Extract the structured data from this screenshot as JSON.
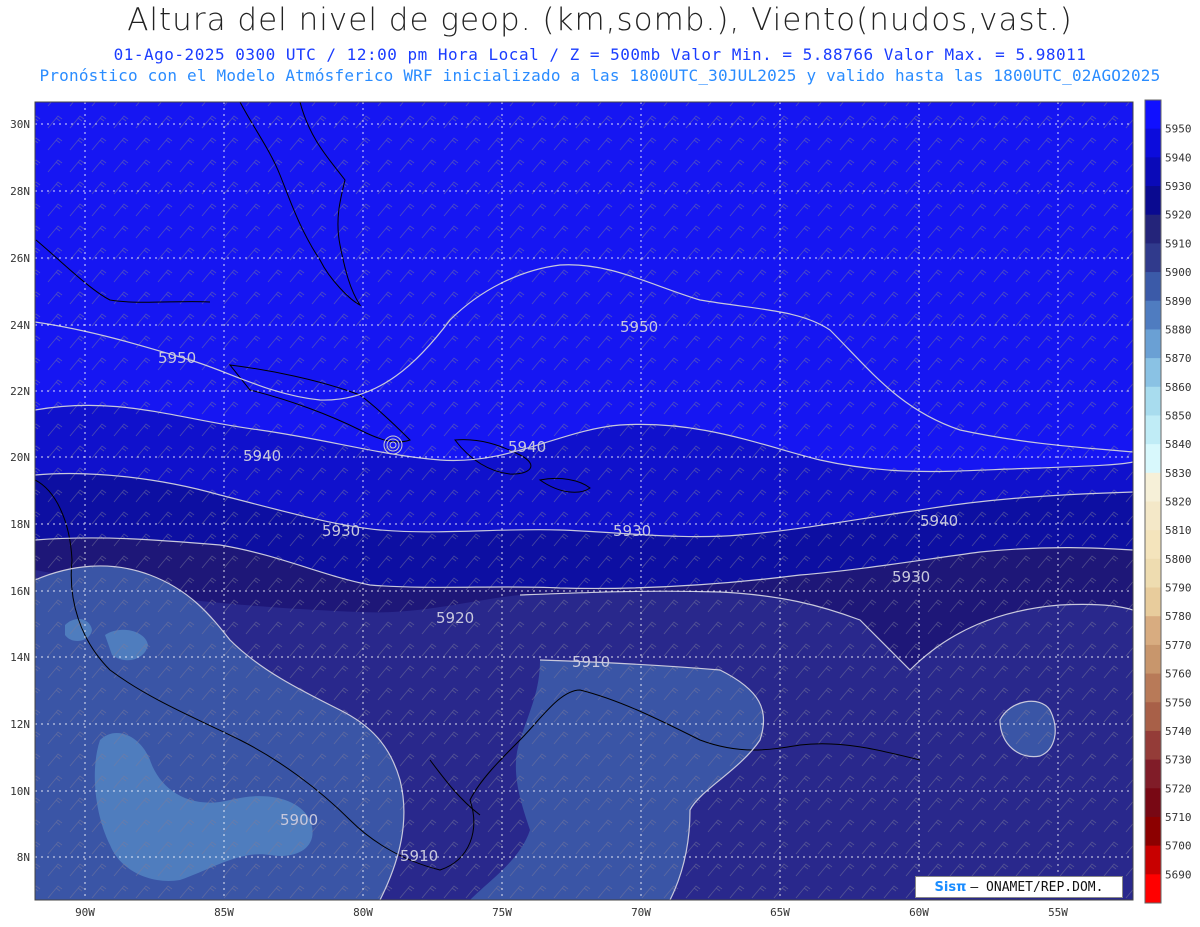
{
  "header": {
    "title": "Altura del nivel de geop. (km,somb.), Viento(nudos,vast.)",
    "line2": "01-Ago-2025  0300 UTC / 12:00 pm Hora Local / Z = 500mb    Valor Min. = 5.88766  Valor Max. = 5.98011",
    "line3": "Pronóstico con el Modelo Atmósferico WRF inicializado a las 1800UTC_30JUL2025 y valido hasta las  1800UTC_02AGO2025"
  },
  "map": {
    "lat_labels": [
      "30N",
      "28N",
      "26N",
      "24N",
      "22N",
      "20N",
      "18N",
      "16N",
      "14N",
      "12N",
      "10N",
      "8N"
    ],
    "lon_labels": [
      "90W",
      "85W",
      "80W",
      "75W",
      "70W",
      "65W",
      "60W",
      "55W"
    ],
    "contour_labels": [
      "5950",
      "5950",
      "5940",
      "5940",
      "5940",
      "5930",
      "5930",
      "5930",
      "5920",
      "5910",
      "5900",
      "5910"
    ],
    "colors": {
      "c5950": "#1414f0",
      "c5940": "#0f10c8",
      "c5930": "#0d0fa0",
      "c5920": "#1e1778",
      "c5910": "#28288c",
      "c5900": "#3a56a8",
      "c5890": "#4f7fc0",
      "grid": "#ffffff",
      "contour": "#c8c8dc"
    }
  },
  "colorbar": {
    "labels": [
      "5950",
      "5940",
      "5930",
      "5920",
      "5910",
      "5900",
      "5890",
      "5880",
      "5870",
      "5860",
      "5850",
      "5840",
      "5830",
      "5820",
      "5810",
      "5800",
      "5790",
      "5780",
      "5770",
      "5760",
      "5750",
      "5740",
      "5730",
      "5720",
      "5710",
      "5700",
      "5690"
    ],
    "colors": [
      "#1010ff",
      "#0c0cdc",
      "#0a0ab8",
      "#0a0a90",
      "#24247a",
      "#303a8c",
      "#3b5aa8",
      "#4f7cc0",
      "#6aa0d4",
      "#8ac2e4",
      "#a8dcee",
      "#c0ecf6",
      "#d8f8fc",
      "#f6f0d8",
      "#f4e8c8",
      "#f4e4bc",
      "#eedcb0",
      "#e8cc9c",
      "#d8ac80",
      "#c8966c",
      "#b87a58",
      "#a86048",
      "#943c38",
      "#801c28",
      "#780814",
      "#8c0000",
      "#c80000",
      "#ff0000"
    ]
  },
  "credit": {
    "logo": "Sisπ",
    "text": "– ONAMET/REP.DOM."
  }
}
